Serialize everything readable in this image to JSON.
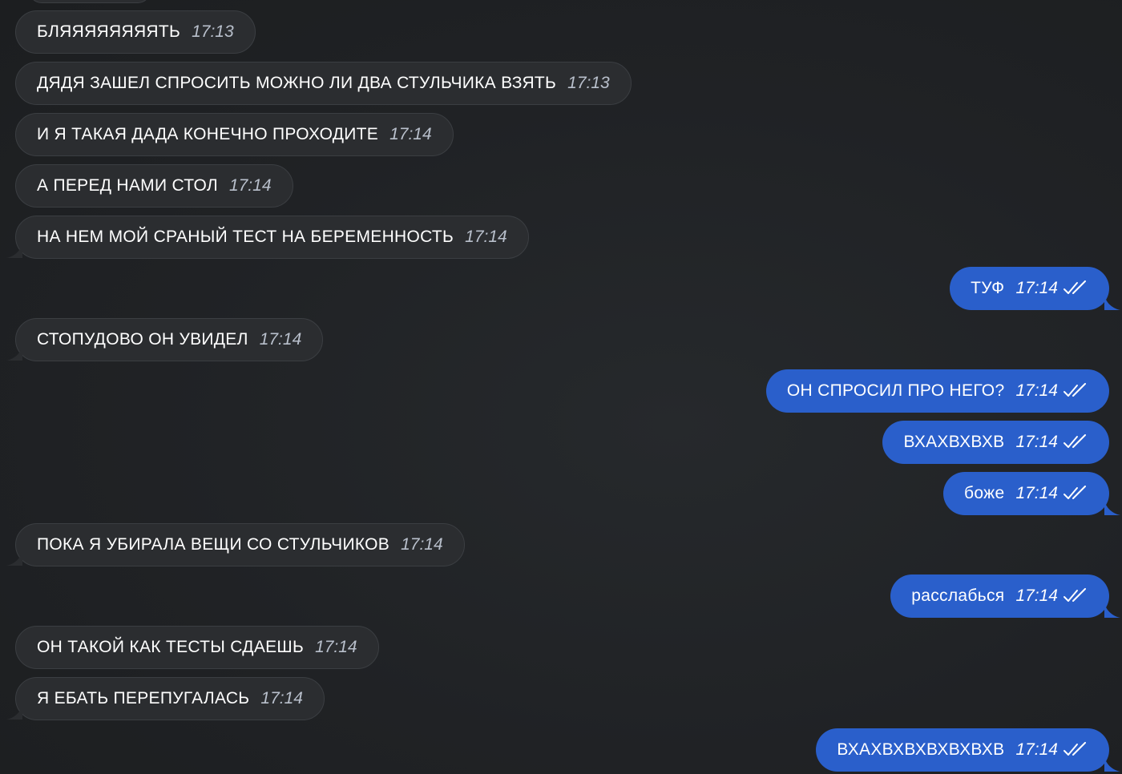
{
  "messages": [
    {
      "side": "in",
      "text": "БЛЯЯЯЯЯЯЯЯТЬ",
      "time": "17:13",
      "tail": false
    },
    {
      "side": "in",
      "text": "ДЯДЯ ЗАШЕЛ СПРОСИТЬ МОЖНО ЛИ ДВА СТУЛЬЧИКА ВЗЯТЬ",
      "time": "17:13",
      "tail": false
    },
    {
      "side": "in",
      "text": "И Я ТАКАЯ ДАДА КОНЕЧНО ПРОХОДИТЕ",
      "time": "17:14",
      "tail": false
    },
    {
      "side": "in",
      "text": "А ПЕРЕД НАМИ СТОЛ",
      "time": "17:14",
      "tail": false
    },
    {
      "side": "in",
      "text": "НА НЕМ МОЙ СРАНЫЙ ТЕСТ НА БЕРЕМЕННОСТЬ",
      "time": "17:14",
      "tail": true
    },
    {
      "side": "out",
      "text": "ТУФ",
      "time": "17:14",
      "tail": true,
      "read": true
    },
    {
      "side": "in",
      "text": "СТОПУДОВО ОН УВИДЕЛ",
      "time": "17:14",
      "tail": true
    },
    {
      "side": "out",
      "text": "ОН СПРОСИЛ ПРО НЕГО?",
      "time": "17:14",
      "tail": false,
      "read": true
    },
    {
      "side": "out",
      "text": "ВХАХВХВХВ",
      "time": "17:14",
      "tail": false,
      "read": true
    },
    {
      "side": "out",
      "text": "боже",
      "time": "17:14",
      "tail": true,
      "read": true
    },
    {
      "side": "in",
      "text": "ПОКА Я УБИРАЛА ВЕЩИ СО СТУЛЬЧИКОВ",
      "time": "17:14",
      "tail": true
    },
    {
      "side": "out",
      "text": "расслабься",
      "time": "17:14",
      "tail": true,
      "read": true
    },
    {
      "side": "in",
      "text": "ОН ТАКОЙ КАК ТЕСТЫ СДАЕШЬ",
      "time": "17:14",
      "tail": false
    },
    {
      "side": "in",
      "text": "Я ЕБАТЬ ПЕРЕПУГАЛАСЬ",
      "time": "17:14",
      "tail": true
    },
    {
      "side": "out",
      "text": "ВХАХВХВХВХВХВХВ",
      "time": "17:14",
      "tail": true,
      "read": true
    }
  ],
  "colors": {
    "background": "#1f2124",
    "incoming_bubble": "#2b2d30",
    "outgoing_bubble": "#2a5fcb",
    "incoming_time": "#b9c0cc"
  },
  "icons": {
    "read_status": "double-check-icon"
  }
}
